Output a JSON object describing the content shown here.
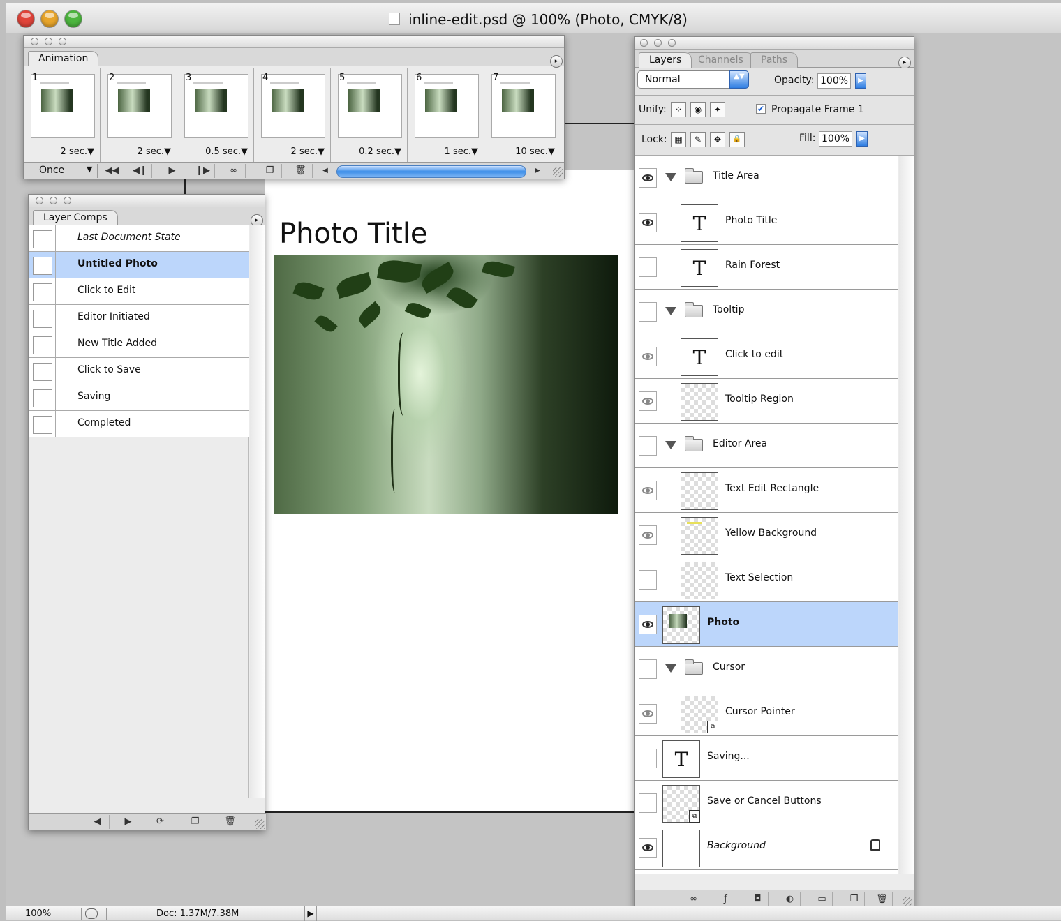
{
  "window": {
    "title": "inline-edit.psd @ 100% (Photo, CMYK/8)",
    "traffic_colors": {
      "close": "#e0443a",
      "minimize": "#e8a52a",
      "zoom": "#4cb53e"
    }
  },
  "canvas": {
    "photo_title": "Photo Title"
  },
  "animation": {
    "tab": "Animation",
    "frames": [
      {
        "num": "1",
        "delay": "2 sec.▼"
      },
      {
        "num": "2",
        "delay": "2 sec.▼"
      },
      {
        "num": "3",
        "delay": "0.5 sec.▼"
      },
      {
        "num": "4",
        "delay": "2 sec.▼"
      },
      {
        "num": "5",
        "delay": "0.2 sec.▼"
      },
      {
        "num": "6",
        "delay": "1 sec.▼"
      },
      {
        "num": "7",
        "delay": "10 sec.▼"
      }
    ],
    "loop": "Once",
    "controls": {
      "first": "◀◀",
      "prev": "◀❙",
      "play": "▶",
      "next": "❙▶",
      "tween": "∞",
      "new": "❐",
      "delete": "🗑",
      "scroll_left": "◀",
      "scroll_right": "▶"
    }
  },
  "layer_comps": {
    "tab": "Layer Comps",
    "items": [
      {
        "label": "Last Document State",
        "style": "italic"
      },
      {
        "label": "Untitled Photo",
        "style": "bold",
        "selected": true
      },
      {
        "label": "Click to Edit"
      },
      {
        "label": "Editor Initiated"
      },
      {
        "label": "New Title Added"
      },
      {
        "label": "Click to Save"
      },
      {
        "label": "Saving"
      },
      {
        "label": "Completed"
      }
    ],
    "footer": {
      "prev": "◀",
      "next": "▶",
      "update": "⟳",
      "new": "❐",
      "delete": "🗑"
    }
  },
  "layers": {
    "tabs": [
      "Layers",
      "Channels",
      "Paths"
    ],
    "blend_mode": "Normal",
    "opacity_label": "Opacity:",
    "opacity": "100%",
    "unify_label": "Unify:",
    "propagate_label": "Propagate Frame 1",
    "lock_label": "Lock:",
    "fill_label": "Fill:",
    "fill": "100%",
    "items": [
      {
        "name": "Title Area"
      },
      {
        "name": "Photo Title"
      },
      {
        "name": "Rain Forest"
      },
      {
        "name": "Tooltip"
      },
      {
        "name": "Click to edit"
      },
      {
        "name": "Tooltip Region"
      },
      {
        "name": "Editor Area"
      },
      {
        "name": "Text Edit Rectangle"
      },
      {
        "name": "Yellow Background"
      },
      {
        "name": "Text Selection"
      },
      {
        "name": "Photo"
      },
      {
        "name": "Cursor"
      },
      {
        "name": "Cursor Pointer"
      },
      {
        "name": "Saving..."
      },
      {
        "name": "Save or Cancel Buttons"
      },
      {
        "name": "Background"
      }
    ],
    "footer": {
      "link": "∞",
      "style": "ƒ",
      "mask": "◘",
      "adjust": "◐",
      "group": "▭",
      "new": "❐",
      "delete": "🗑"
    }
  },
  "status": {
    "zoom": "100%",
    "doc": "Doc: 1.37M/7.38M",
    "arrow": "▶"
  },
  "icons": {
    "menu": "▸",
    "select_arrow": "▼",
    "stepper": "▲▼",
    "checkmark": "✔",
    "field_arrow": "▶",
    "lock_transparent": "▦",
    "lock_paint": "✎",
    "lock_move": "✥",
    "lock_all": "🔒",
    "unify_position": "⁘",
    "unify_visibility": "◉",
    "unify_style": "✦",
    "type": "T",
    "smart_object": "⧉"
  }
}
